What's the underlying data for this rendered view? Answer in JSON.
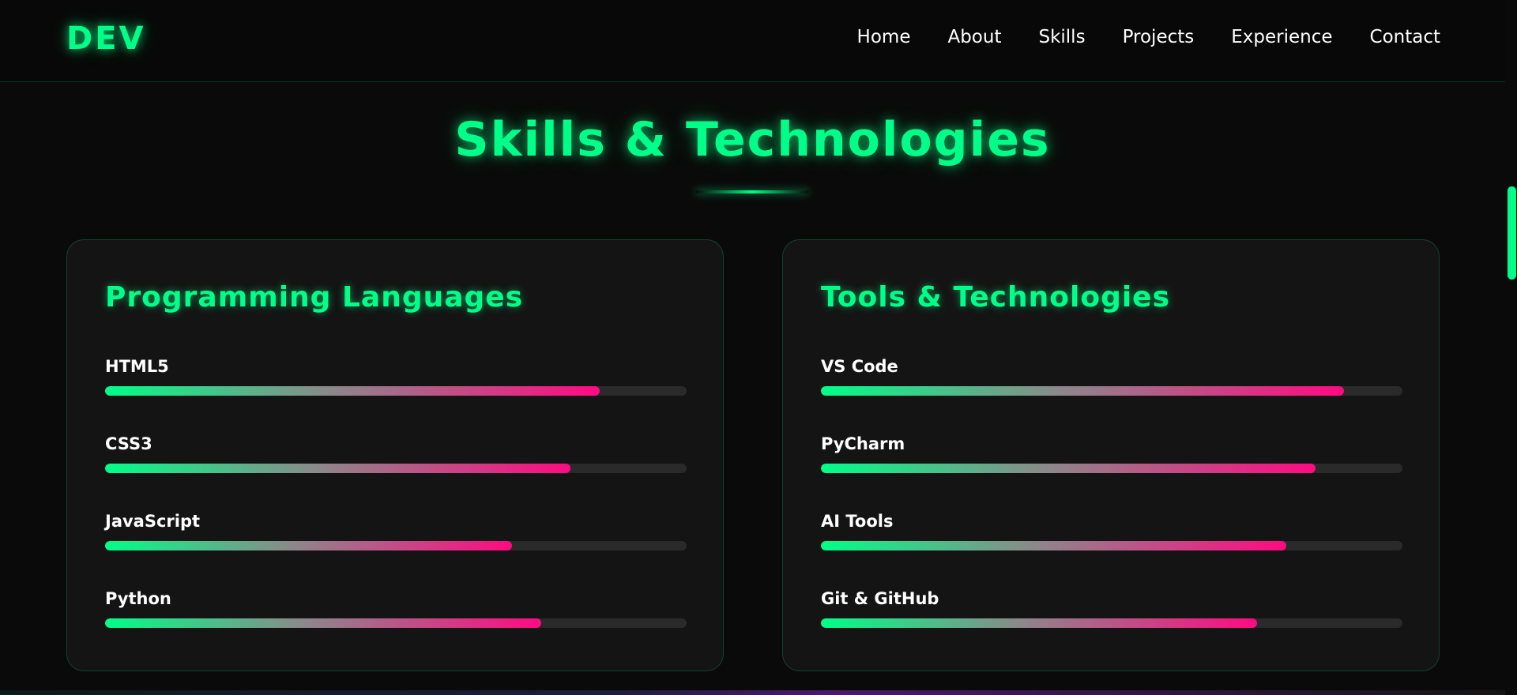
{
  "nav": {
    "logo": "DEV",
    "links": [
      "Home",
      "About",
      "Skills",
      "Projects",
      "Experience",
      "Contact"
    ]
  },
  "section": {
    "title": "Skills & Technologies"
  },
  "cards": [
    {
      "title": "Programming Languages",
      "skills": [
        {
          "name": "HTML5",
          "level": 85
        },
        {
          "name": "CSS3",
          "level": 80
        },
        {
          "name": "JavaScript",
          "level": 70
        },
        {
          "name": "Python",
          "level": 75
        }
      ]
    },
    {
      "title": "Tools & Technologies",
      "skills": [
        {
          "name": "VS Code",
          "level": 90
        },
        {
          "name": "PyCharm",
          "level": 85
        },
        {
          "name": "AI Tools",
          "level": 80
        },
        {
          "name": "Git & GitHub",
          "level": 75
        }
      ]
    }
  ],
  "colors": {
    "accent": "#00ff88",
    "bar_end": "#ff0a82",
    "background": "#0a0a0a",
    "card": "#141414"
  }
}
